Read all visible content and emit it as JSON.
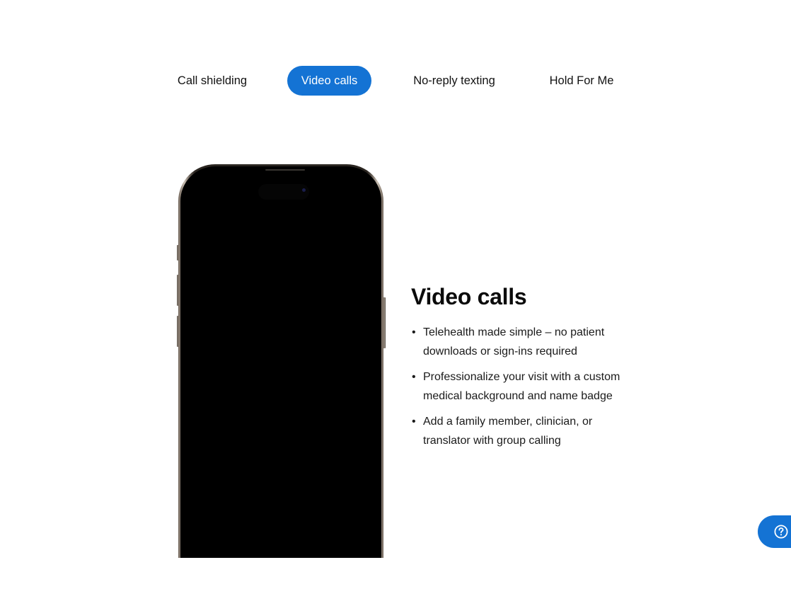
{
  "tabs": [
    {
      "label": "Call shielding",
      "active": false
    },
    {
      "label": "Video calls",
      "active": true
    },
    {
      "label": "No-reply texting",
      "active": false
    },
    {
      "label": "Hold For Me",
      "active": false
    }
  ],
  "feature": {
    "title": "Video calls",
    "bullets": [
      "Telehealth made simple – no patient downloads or sign-ins required",
      "Professionalize your visit with a custom medical background and name badge",
      "Add a family member, clinician, or translator with group calling"
    ]
  },
  "help": {
    "icon": "question-circle-icon"
  },
  "colors": {
    "accent": "#1473d4",
    "text": "#111111",
    "background": "#ffffff"
  }
}
